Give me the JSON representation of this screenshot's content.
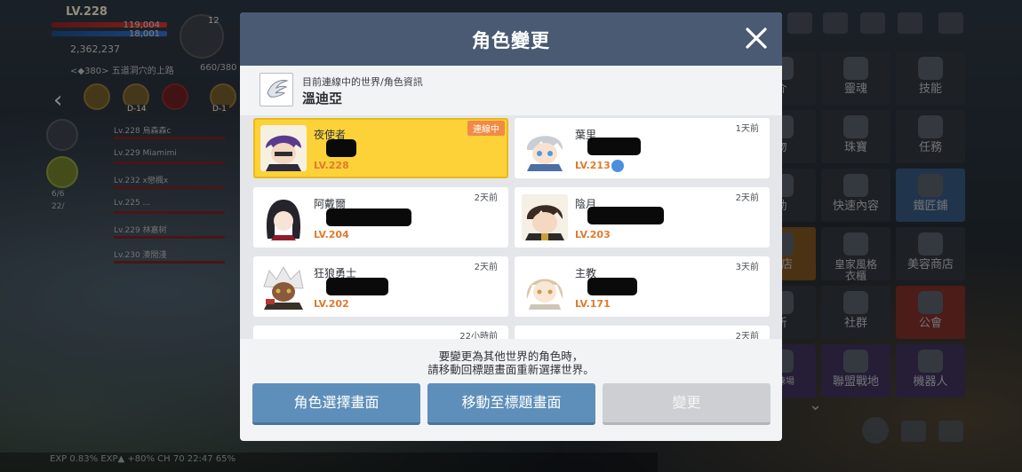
{
  "hud": {
    "level": "LV.228",
    "hp": "119,004",
    "mp": "18,001",
    "meso": "2,362,237",
    "location": "<◆380> 五道洞穴的上路",
    "arcane": "660/380",
    "emblem_count": "12",
    "buff_tags": [
      "D-14",
      "D-1"
    ],
    "side_counts": [
      "6/6",
      "22/"
    ]
  },
  "party": [
    {
      "text": "Lv.228   烏森森c"
    },
    {
      "text": "Lv.229   Miamimi"
    },
    {
      "text": "Lv.232   x戀楓x"
    },
    {
      "text": "Lv.225   ..."
    },
    {
      "text": "Lv.229   林嘉树"
    },
    {
      "text": "Lv.230   湊閒淺"
    }
  ],
  "status_bar": "EXP 0.83%   EXP▲ +80%   CH 70   22:47   65%",
  "right_menu": {
    "tiles": [
      "介",
      "靈魂",
      "技能",
      "物",
      "珠寶",
      "任務",
      "動",
      "快速內容",
      "鐵匠鋪",
      "商店",
      "皇家風格\n衣櫃",
      "美容商店",
      "所",
      "社群",
      "公會",
      "修練場",
      "聯盟戰地",
      "機器人"
    ]
  },
  "modal": {
    "title": "角色變更",
    "world_subtitle": "目前連線中的世界/角色資訊",
    "world_name": "溫迪亞",
    "characters": [
      {
        "class": "夜使者",
        "level": "LV.228",
        "time": "",
        "badge": "連線中",
        "selected": true
      },
      {
        "class": "葉里",
        "level": "LV.213",
        "time": "1天前",
        "badge": "",
        "selected": false
      },
      {
        "class": "阿戴爾",
        "level": "LV.204",
        "time": "2天前",
        "badge": "",
        "selected": false
      },
      {
        "class": "陰月",
        "level": "LV.203",
        "time": "2天前",
        "badge": "",
        "selected": false
      },
      {
        "class": "狂狼勇士",
        "level": "LV.202",
        "time": "2天前",
        "badge": "",
        "selected": false
      },
      {
        "class": "主教",
        "level": "LV.171",
        "time": "3天前",
        "badge": "",
        "selected": false
      },
      {
        "class": "",
        "level": "",
        "time": "22小時前",
        "badge": "",
        "selected": false
      },
      {
        "class": "",
        "level": "",
        "time": "2天前",
        "badge": "",
        "selected": false
      }
    ],
    "notice_line1": "要變更為其他世界的角色時，",
    "notice_line2": "請移動回標題畫面重新選擇世界。",
    "buttons": {
      "character_select": "角色選擇畫面",
      "move_to_title": "移動至標題畫面",
      "change": "變更"
    }
  },
  "colors": {
    "header": "#495a72",
    "selected_card": "#fdd238",
    "level_text": "#e07a2e",
    "online_badge": "#f08a46",
    "primary_button": "#5e8fba",
    "disabled_button": "#cdcfd2"
  }
}
